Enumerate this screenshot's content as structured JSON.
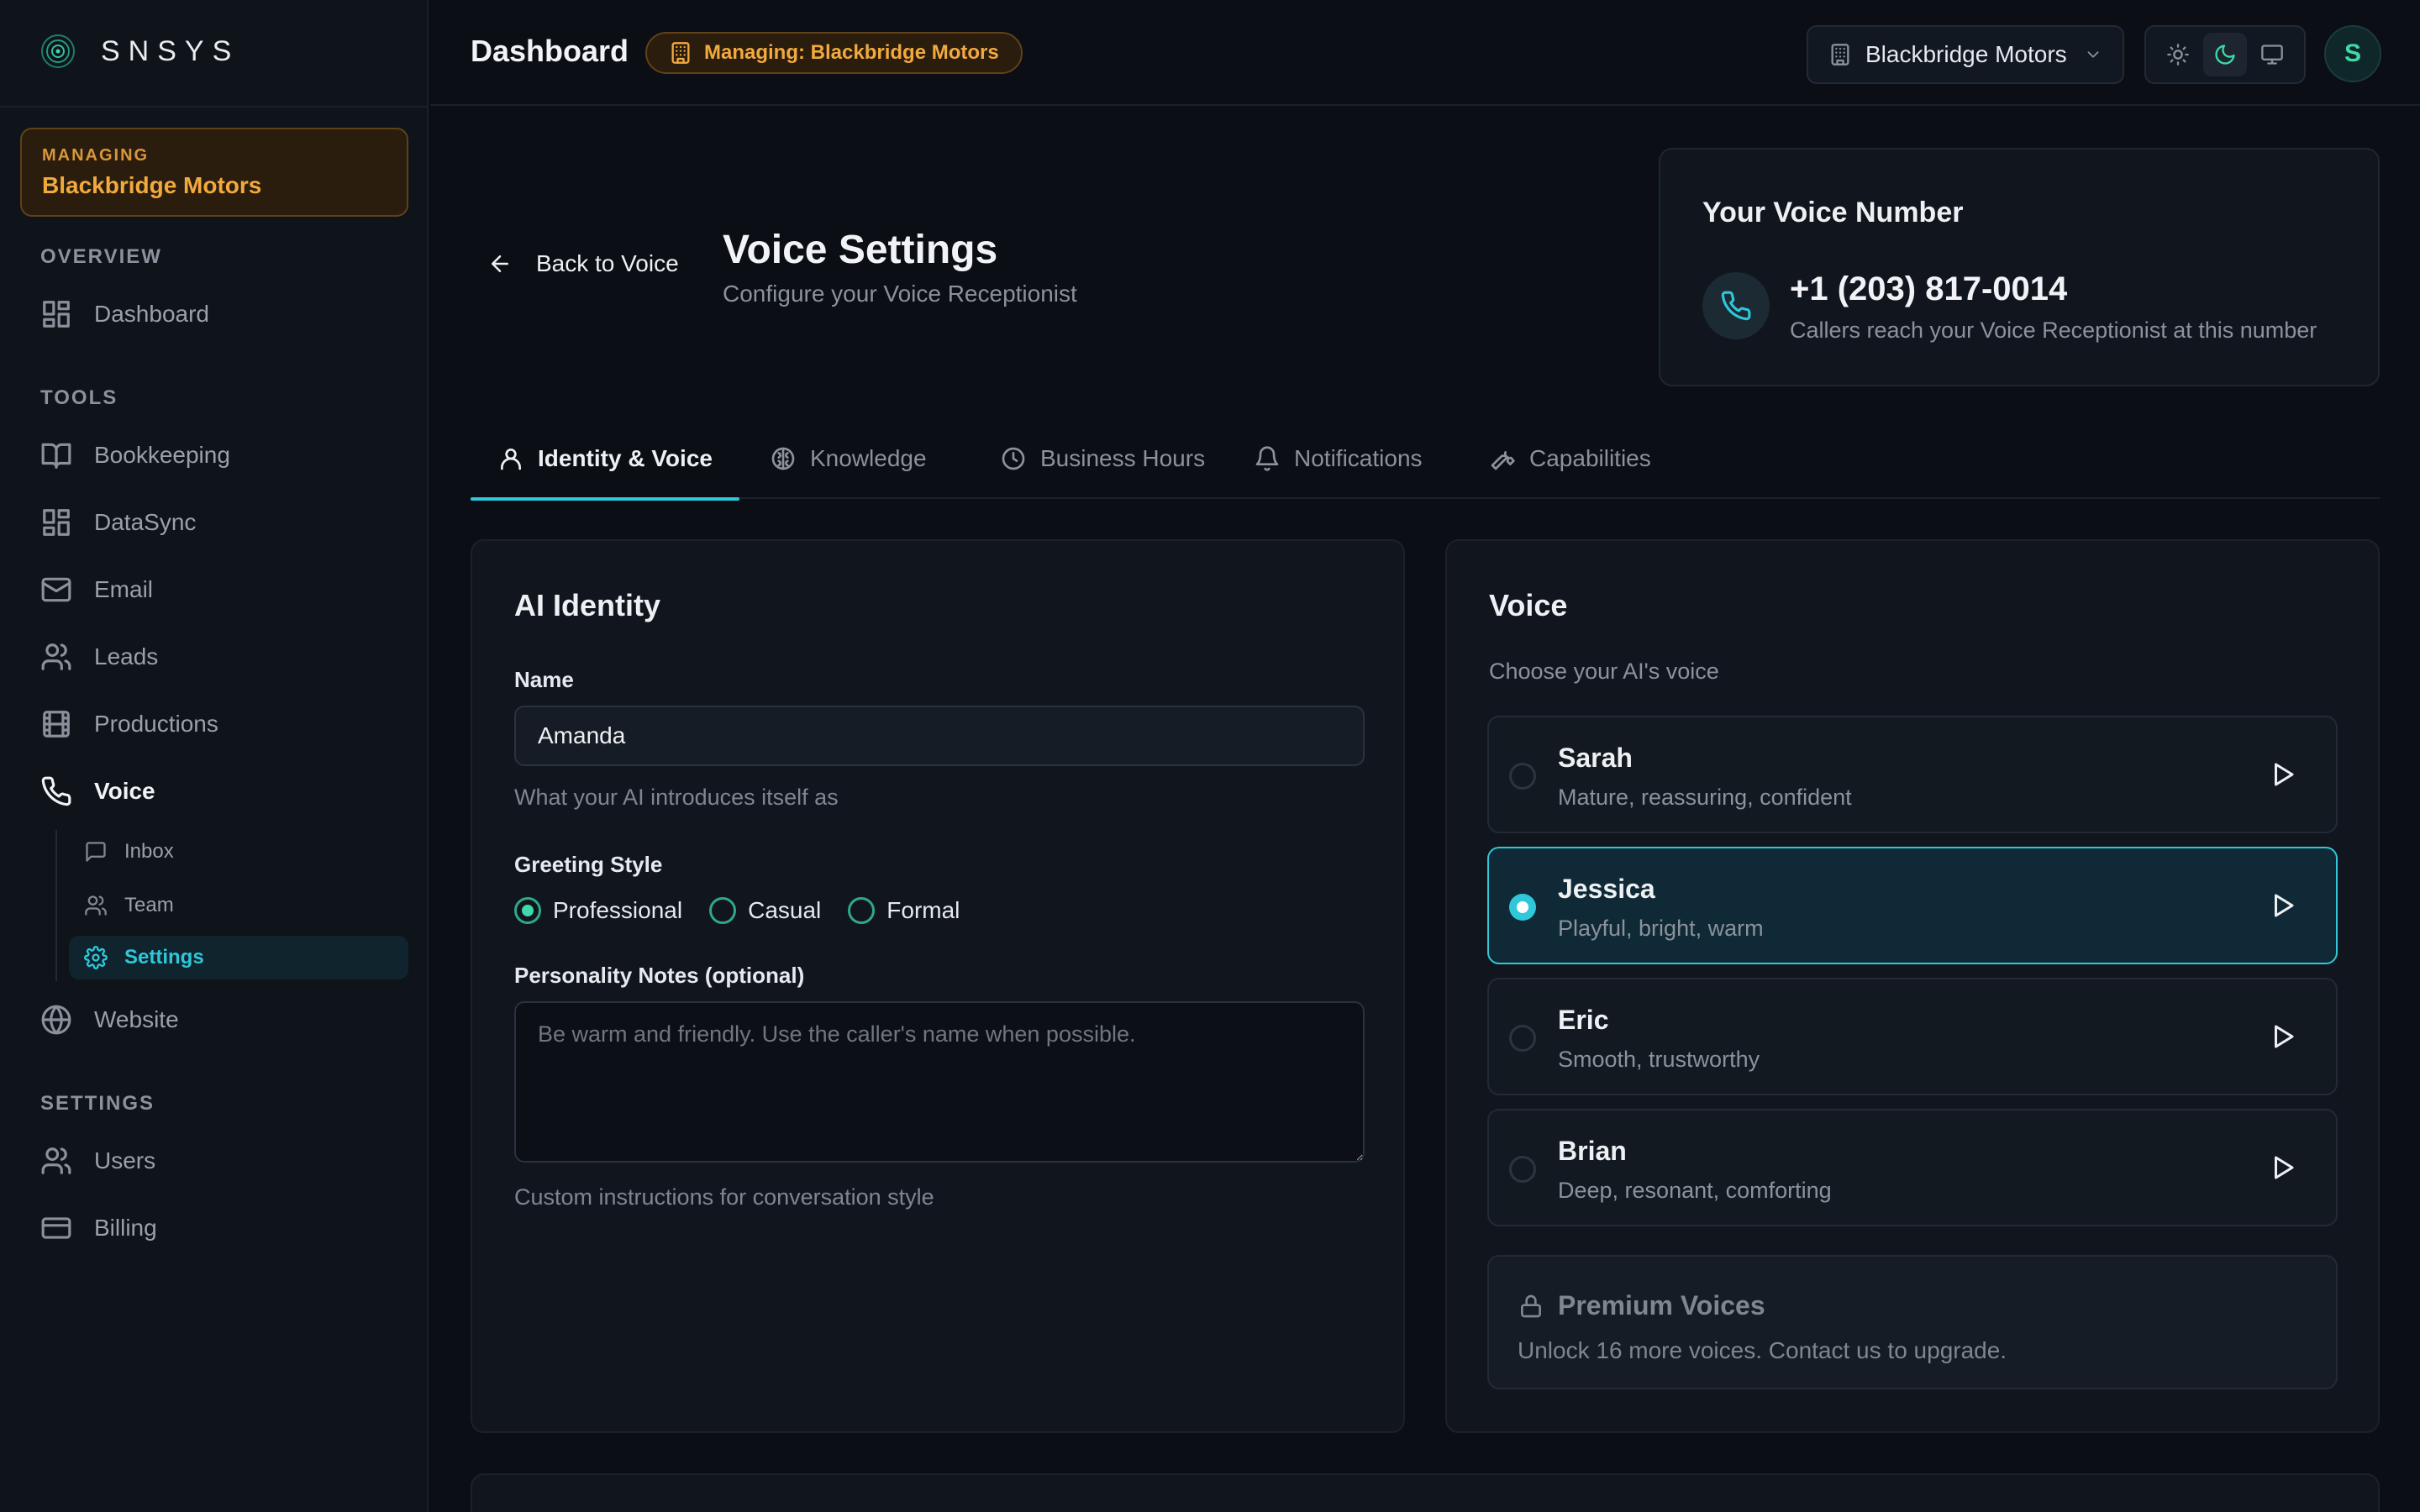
{
  "brand": {
    "name": "SNSYS",
    "logo_icon": "radar-logo-icon",
    "accent": "#2fc7d9"
  },
  "managing_card": {
    "label": "MANAGING",
    "org": "Blackbridge Motors"
  },
  "sidebar": {
    "sections": {
      "overview": "OVERVIEW",
      "tools": "TOOLS",
      "settings": "SETTINGS"
    },
    "items": [
      {
        "label": "Dashboard",
        "icon": "grid-icon"
      },
      {
        "label": "Bookkeeping",
        "icon": "book-icon"
      },
      {
        "label": "DataSync",
        "icon": "grid-icon"
      },
      {
        "label": "Email",
        "icon": "mail-icon"
      },
      {
        "label": "Leads",
        "icon": "users-icon"
      },
      {
        "label": "Productions",
        "icon": "film-icon"
      },
      {
        "label": "Voice",
        "icon": "phone-icon",
        "active": true
      },
      {
        "label": "Website",
        "icon": "globe-icon"
      },
      {
        "label": "Users",
        "icon": "users-icon"
      },
      {
        "label": "Billing",
        "icon": "credit-card-icon"
      }
    ],
    "voice_sub": [
      {
        "label": "Inbox",
        "icon": "message-icon"
      },
      {
        "label": "Team",
        "icon": "users-icon"
      },
      {
        "label": "Settings",
        "icon": "gear-icon",
        "active": true
      }
    ]
  },
  "header": {
    "title": "Dashboard",
    "managing_badge": "Managing: Blackbridge Motors",
    "org_select": "Blackbridge Motors",
    "avatar_initial": "S"
  },
  "page": {
    "back_label": "Back to Voice",
    "title": "Voice Settings",
    "subtitle": "Configure your Voice Receptionist"
  },
  "voice_number": {
    "title": "Your Voice Number",
    "number": "+1 (203) 817-0014",
    "description": "Callers reach your Voice Receptionist at this number"
  },
  "tabs": [
    {
      "label": "Identity & Voice",
      "icon": "user-icon",
      "active": true
    },
    {
      "label": "Knowledge",
      "icon": "brain-icon"
    },
    {
      "label": "Business Hours",
      "icon": "clock-icon"
    },
    {
      "label": "Notifications",
      "icon": "bell-icon"
    },
    {
      "label": "Capabilities",
      "icon": "wrench-icon"
    }
  ],
  "identity": {
    "title": "AI Identity",
    "name_label": "Name",
    "name_value": "Amanda",
    "name_help": "What your AI introduces itself as",
    "greeting_label": "Greeting Style",
    "greeting_options": [
      "Professional",
      "Casual",
      "Formal"
    ],
    "greeting_selected": "Professional",
    "notes_label": "Personality Notes (optional)",
    "notes_placeholder": "Be warm and friendly. Use the caller's name when possible.",
    "notes_help": "Custom instructions for conversation style"
  },
  "voice": {
    "title": "Voice",
    "subtitle": "Choose your AI's voice",
    "options": [
      {
        "name": "Sarah",
        "desc": "Mature, reassuring, confident"
      },
      {
        "name": "Jessica",
        "desc": "Playful, bright, warm",
        "selected": true
      },
      {
        "name": "Eric",
        "desc": "Smooth, trustworthy"
      },
      {
        "name": "Brian",
        "desc": "Deep, resonant, comforting"
      }
    ],
    "premium_title": "Premium Voices",
    "premium_desc": "Unlock 16 more voices. Contact us to upgrade."
  }
}
